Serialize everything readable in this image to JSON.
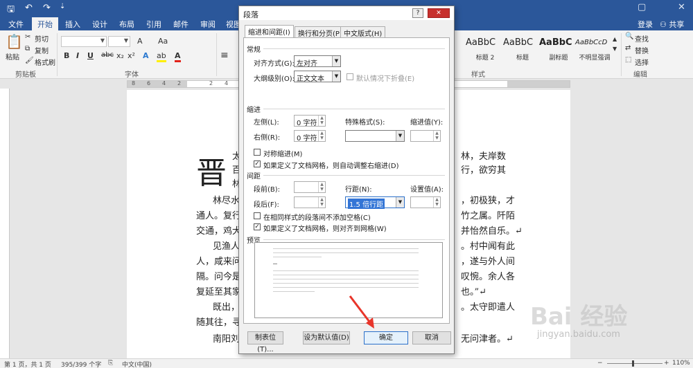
{
  "titlebar": {
    "icons": [
      "save-icon",
      "undo-icon",
      "redo-icon",
      "customize-icon"
    ],
    "undo_glyph": "↶",
    "redo_glyph": "↷",
    "save_glyph": "🖫",
    "more_glyph": "⇣",
    "restore_glyph": "▢",
    "close_glyph": "✕"
  },
  "tabs": {
    "items": [
      "文件",
      "开始",
      "插入",
      "设计",
      "布局",
      "引用",
      "邮件",
      "审阅",
      "视图"
    ],
    "login": "登录",
    "share": "共享"
  },
  "ribbon": {
    "clipboard": {
      "paste": "粘贴",
      "cut": "剪切",
      "copy": "复制",
      "format_painter": "格式刷",
      "group": "剪贴板"
    },
    "font": {
      "group": "字体",
      "bold": "B",
      "italic": "I",
      "underline": "U",
      "strike": "abc",
      "sub": "x₂",
      "sup": "x²",
      "aa": "Aa",
      "grow": "A"
    },
    "styles": {
      "group": "样式",
      "items": [
        {
          "sample": "AaBbC",
          "name": "标题 2"
        },
        {
          "sample": "AaBbC",
          "name": "标题"
        },
        {
          "sample": "AaBbC",
          "name": "副标题"
        },
        {
          "sample": "AaBbCcD",
          "name": "不明显强调"
        }
      ]
    },
    "editing": {
      "group": "编辑",
      "find": "查找",
      "replace": "替换",
      "select": "选择"
    }
  },
  "ruler": {
    "nums": [
      "8",
      "6",
      "4",
      "2",
      "2",
      "4"
    ]
  },
  "document": {
    "dropcap": "晋",
    "lines": [
      "太",
      "林，夫岸数",
      "百",
      "行，欲穷其",
      "林",
      "林尽水",
      "，初极狭，才",
      "通人。复行",
      "竹之属。阡陌",
      "交通，鸡犬",
      "并怡然自乐。↵",
      "见渔人",
      "。村中闻有此",
      "人，咸来问",
      "，遂与外人间",
      "隔。问今是",
      "叹惋。余人各",
      "复延至其家",
      "也。”↵",
      "既出，",
      "。太守即遣人",
      "随其往，寻",
      "南阳刘",
      "无问津者。↵"
    ]
  },
  "dialog": {
    "title": "段落",
    "help": "?",
    "close": "✕",
    "tabs": [
      "缩进和间距(I)",
      "换行和分页(P)",
      "中文版式(H)"
    ],
    "general": {
      "heading": "常规",
      "alignment_label": "对齐方式(G):",
      "alignment_value": "左对齐",
      "outline_label": "大纲级别(O):",
      "outline_value": "正文文本",
      "collapsed_label": "默认情况下折叠(E)"
    },
    "indent": {
      "heading": "缩进",
      "left_label": "左侧(L):",
      "left_value": "0 字符",
      "right_label": "右侧(R):",
      "right_value": "0 字符",
      "special_label": "特殊格式(S):",
      "special_value": "",
      "by_label": "缩进值(Y):",
      "mirror_label": "对称缩进(M)",
      "auto_adjust_label": "如果定义了文档网格，则自动调整右缩进(D)"
    },
    "spacing": {
      "heading": "间距",
      "before_label": "段前(B):",
      "after_label": "段后(F):",
      "line_label": "行距(N):",
      "line_value": "1.5 倍行距",
      "at_label": "设置值(A):",
      "no_space_label": "在相同样式的段落间不添加空格(C)",
      "snap_grid_label": "如果定义了文档网格，则对齐到网格(W)"
    },
    "preview": {
      "heading": "预览"
    },
    "buttons": {
      "tabs": "制表位(T)...",
      "default": "设为默认值(D)",
      "ok": "确定",
      "cancel": "取消"
    },
    "checked_glyph": "✓",
    "arrow_glyph": "▼",
    "spin_glyph_up": "▲",
    "spin_glyph_down": "▼"
  },
  "status": {
    "page": "第 1 页，共 1 页",
    "words": "395/399 个字",
    "lang": "中文(中国)",
    "zoom": "110%",
    "minus": "−",
    "plus": "+"
  },
  "colors": {
    "accent": "#2b579a",
    "arrow": "#e8352a",
    "selection": "#3375d6"
  },
  "watermark": {
    "brand": "Bai 经验",
    "url": "jingyan.baidu.com"
  }
}
